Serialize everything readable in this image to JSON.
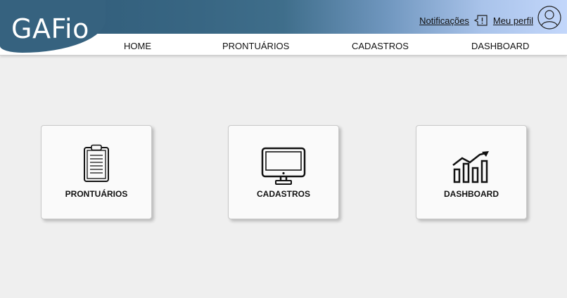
{
  "app": {
    "logo_text": "GAFio"
  },
  "header": {
    "notifications_label": "Notificações",
    "profile_label": "Meu perfil"
  },
  "nav": {
    "items": [
      {
        "label": "HOME"
      },
      {
        "label": "PRONTUÁRIOS"
      },
      {
        "label": "CADASTROS"
      },
      {
        "label": "DASHBOARD"
      }
    ]
  },
  "cards": [
    {
      "label": "PRONTUÁRIOS",
      "icon": "clipboard-icon"
    },
    {
      "label": "CADASTROS",
      "icon": "monitor-icon"
    },
    {
      "label": "DASHBOARD",
      "icon": "chart-icon"
    }
  ],
  "colors": {
    "header_dark": "#2f5a77",
    "header_light": "#c3d7fb",
    "logo_blob": "#36627f",
    "page_bg": "#efefef"
  }
}
